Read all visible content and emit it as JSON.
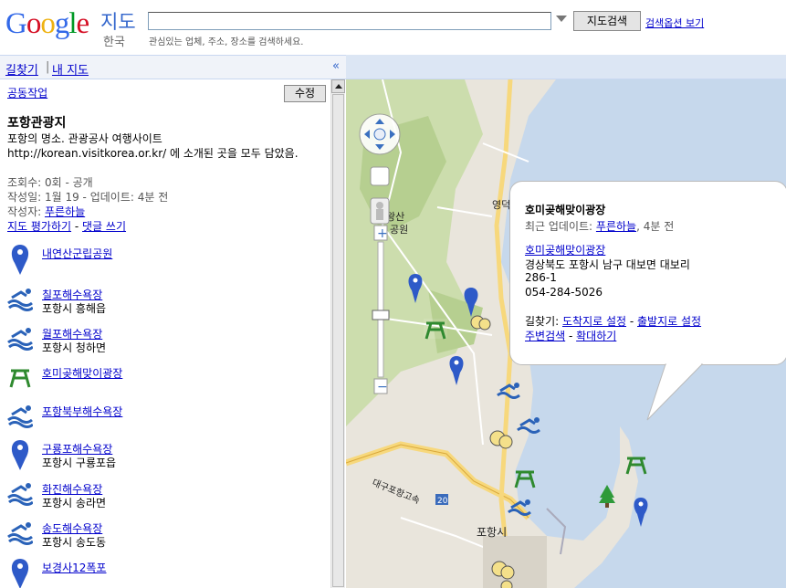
{
  "header": {
    "logo_text": "Google",
    "product_name": "지도",
    "region": "한국",
    "search_value": "",
    "search_button": "지도검색",
    "search_options": "검색옵션 보기",
    "search_hint": "관심있는 업체, 주소, 장소를 검색하세요."
  },
  "toolbar": {
    "directions": "길찾기",
    "my_maps": "내 지도",
    "separator": "|",
    "collapse": "«"
  },
  "panel": {
    "collab": "공동작업",
    "edit": "수정",
    "title": "포항관광지",
    "description": "포항의 명소. 관광공사 여행사이트 http://korean.visitkorea.or.kr/ 에 소개된 곳을 모두 담았음.",
    "views_label": "조회수: 0회 - 공개",
    "created_label": "작성일: 1월 19 - 업데이트: 4분 전",
    "author_prefix": "작성자: ",
    "author_name": "푸른하늘",
    "rate_link": "지도 평가하기",
    "rate_sep": " - ",
    "comment_link": "댓글 쓰기"
  },
  "places": [
    {
      "name": "내연산군립공원",
      "sub": "",
      "icon": "blue-pin-icon"
    },
    {
      "name": "칠포해수욕장",
      "sub": "포항시 흥해읍",
      "icon": "swimmer-icon"
    },
    {
      "name": "월포해수욕장",
      "sub": "포항시 청하면",
      "icon": "swimmer-icon"
    },
    {
      "name": "호미곶해맞이광장",
      "sub": "",
      "icon": "picnic-table-icon"
    },
    {
      "name": "포항북부해수욕장",
      "sub": "",
      "icon": "swimmer-icon"
    },
    {
      "name": "구룡포해수욕장",
      "sub": "포항시 구룡포읍",
      "icon": "blue-pin-icon"
    },
    {
      "name": "화진해수욕장",
      "sub": "포항시 송라면",
      "icon": "swimmer-icon"
    },
    {
      "name": "송도해수욕장",
      "sub": "포항시 송도동",
      "icon": "swimmer-icon"
    },
    {
      "name": "보경사12폭포",
      "sub": "",
      "icon": "blue-pin-icon"
    }
  ],
  "map": {
    "labels": {
      "yeongdeok": "영덕군",
      "mountain1": "왕산",
      "mountain2": "공원",
      "pohang": "포항시",
      "expressway": "대구포항고속",
      "route": "20"
    }
  },
  "callout": {
    "title": "호미곶해맞이광장",
    "updated_prefix": "최근 업데이트: ",
    "updated_author": "푸른하늘",
    "updated_suffix": ", 4분 전",
    "place_link": "호미곶해맞이광장",
    "address": "경상북도 포항시 남구 대보면 대보리",
    "lot": "286-1",
    "phone": "054-284-5026",
    "dir_prefix": "길찾기: ",
    "to_here": "도착지로 설정",
    "dir_sep": " - ",
    "from_here": "출발지로 설정",
    "nearby": "주변검색",
    "zoom": "확대하기"
  },
  "colors": {
    "link": "#0000cc",
    "sea": "#c6d8ec",
    "land": "#e9e5dc",
    "green": "#c9dba7",
    "road": "#f7d87c"
  }
}
